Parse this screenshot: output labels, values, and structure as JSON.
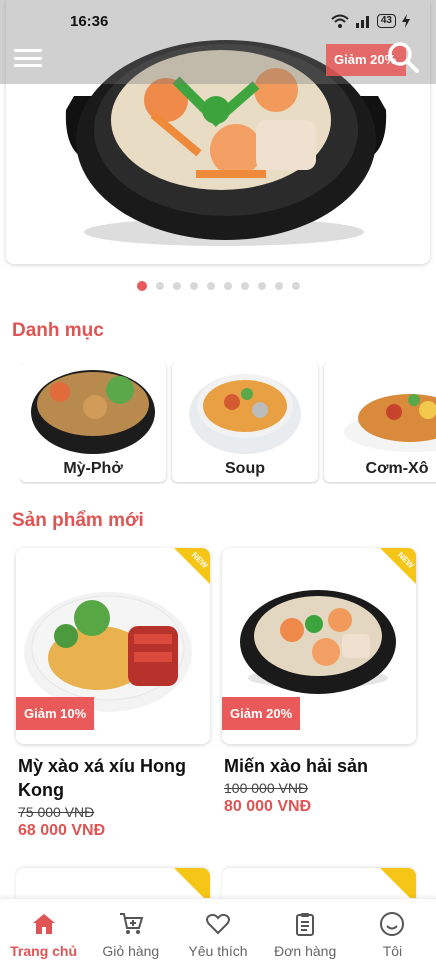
{
  "status_bar": {
    "time": "16:36",
    "battery": "43"
  },
  "banner": {
    "badge": "Giảm 20%"
  },
  "carousel": {
    "count": 10,
    "active_index": 0
  },
  "sections": {
    "categories_title": "Danh mục",
    "new_products_title": "Sản phẩm mới"
  },
  "categories": [
    {
      "label": "Mỳ-Phở"
    },
    {
      "label": "Soup"
    },
    {
      "label": "Cơm-Xô"
    }
  ],
  "products": [
    {
      "name": "Mỳ xào xá xíu Hong Kong",
      "old_price": "75 000 VNĐ",
      "new_price": "68 000 VNĐ",
      "discount": "Giảm 10%",
      "badge": "NEW"
    },
    {
      "name": "Miến xào hải sản",
      "old_price": "100 000 VNĐ",
      "new_price": "80 000 VNĐ",
      "discount": "Giảm 20%",
      "badge": "NEW"
    }
  ],
  "bottom_nav": [
    {
      "label": "Trang chủ",
      "icon": "home-icon",
      "active": true
    },
    {
      "label": "Giỏ hàng",
      "icon": "cart-icon",
      "active": false
    },
    {
      "label": "Yêu thích",
      "icon": "heart-icon",
      "active": false
    },
    {
      "label": "Đơn hàng",
      "icon": "clipboard-icon",
      "active": false
    },
    {
      "label": "Tôi",
      "icon": "smiley-icon",
      "active": false
    }
  ],
  "colors": {
    "accent": "#e05454",
    "badge_yellow": "#f5c518"
  }
}
